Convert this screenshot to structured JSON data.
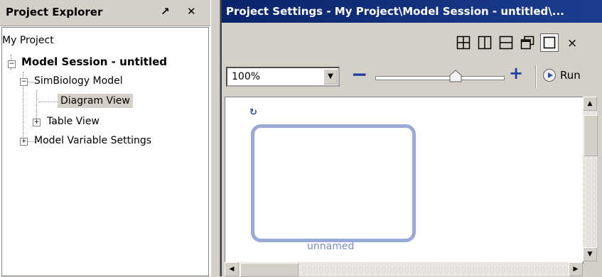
{
  "explorer": {
    "title": "Project Explorer",
    "tree": {
      "root": "My Project",
      "session": "Model Session - untitled",
      "model": "SimBiology Model",
      "diagram_view": "Diagram View",
      "table_view": "Table View",
      "variables": "Model Variable Settings"
    }
  },
  "settings": {
    "title": "Project Settings - My Project\\Model Session - untitled\\...",
    "close_glyph": "×",
    "zoom": {
      "value": "100%",
      "minus": "−",
      "plus": "+"
    },
    "slider_value": 0.62,
    "run_label": "Run",
    "compartment_label": "unnamed"
  },
  "colors": {
    "title_bar": "#0a246a",
    "accent": "#2040a0",
    "compartment_border": "#9aaad8"
  }
}
